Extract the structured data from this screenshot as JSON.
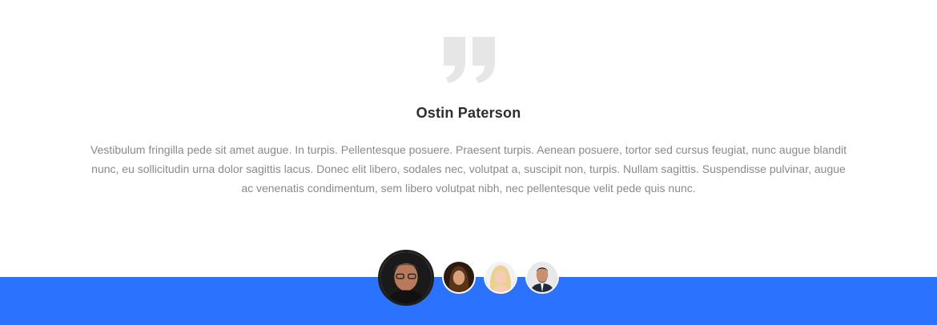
{
  "testimonial": {
    "quote_icon": "quote-icon",
    "author_name": "Ostin Paterson",
    "text": "Vestibulum fringilla pede sit amet augue. In turpis. Pellentesque posuere. Praesent turpis. Aenean posuere, tortor sed cursus feugiat, nunc augue blandit nunc, eu sollicitudin urna dolor sagittis lacus. Donec elit libero, sodales nec, volutpat a, suscipit non, turpis. Nullam sagittis. Suspendisse pulvinar, augue ac venenatis condimentum, sem libero volutpat nibh, nec pellentesque velit pede quis nunc."
  },
  "avatars": [
    {
      "name": "avatar-ostin-paterson",
      "active": true
    },
    {
      "name": "avatar-2",
      "active": false
    },
    {
      "name": "avatar-3",
      "active": false
    },
    {
      "name": "avatar-4",
      "active": false
    }
  ],
  "colors": {
    "accent": "#2b73ff",
    "quote_icon": "#e6e6e6",
    "text": "#8a8a8a",
    "heading": "#2d2d2d"
  }
}
